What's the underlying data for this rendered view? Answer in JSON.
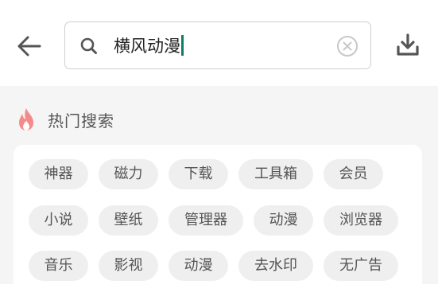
{
  "search": {
    "value": "横风动漫"
  },
  "hot": {
    "title": "热门搜索",
    "rows": [
      [
        "神器",
        "磁力",
        "下载",
        "工具箱",
        "会员"
      ],
      [
        "小说",
        "壁纸",
        "管理器",
        "动漫",
        "浏览器"
      ],
      [
        "音乐",
        "影视",
        "动漫",
        "去水印",
        "无广告"
      ]
    ]
  },
  "icons": {
    "back": "arrow-left-icon",
    "search": "search-icon",
    "clear": "clear-circle-icon",
    "download": "download-icon",
    "fire": "fire-icon"
  },
  "colors": {
    "caret": "#0f7b6c",
    "fire": "#f58a8a",
    "tag_bg": "#efefef",
    "content_bg": "#f5f5f5"
  }
}
